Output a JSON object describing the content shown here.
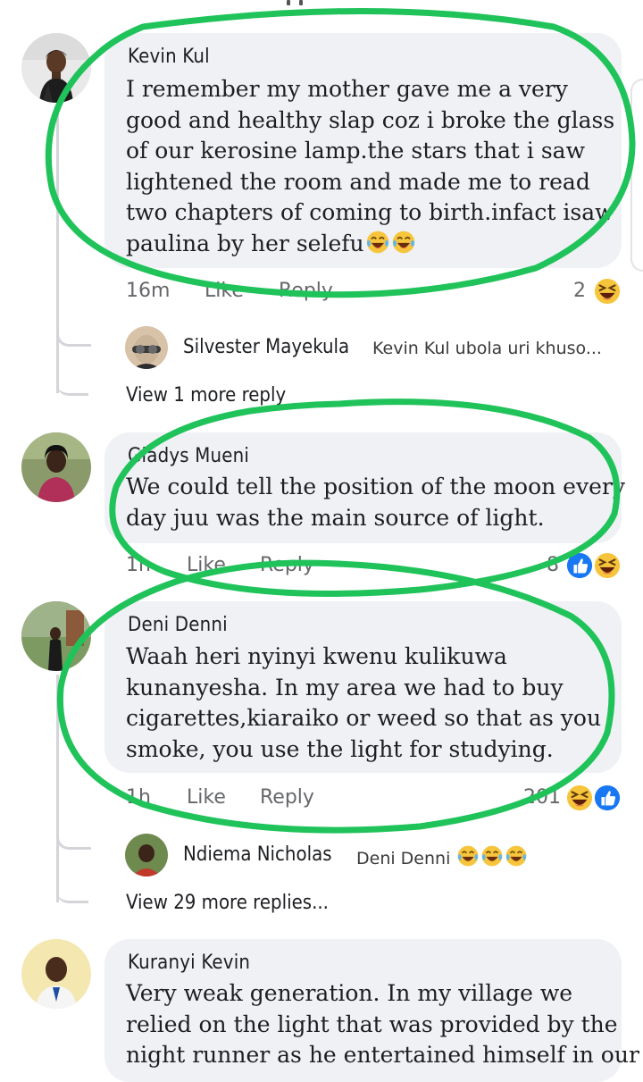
{
  "comments": [
    {
      "author": "Kevin Kul",
      "lines": [
        "I remember my mother gave me a very",
        "good and healthy slap coz i broke the glass",
        "of our kerosine lamp.the stars that i saw",
        "lightened the room and  made me to read",
        "two chapters of coming to birth.infact isaw",
        "paulina by her selefu"
      ],
      "time": "16m",
      "like": "Like",
      "reply": "Reply",
      "reaction_count": "2",
      "reactions": [
        "laugh-squint-emoji"
      ],
      "inline_emojis": [
        "tears-of-joy-emoji",
        "tears-of-joy-emoji"
      ],
      "replies": [
        {
          "name": "Silvester Mayekula",
          "snippet": "Kevin Kul ubola uri khuso..."
        }
      ],
      "view_more": "View 1 more reply"
    },
    {
      "author": "Gladys Mueni",
      "lines": [
        "We could tell the position of the moon every",
        "day juu was the main source of light."
      ],
      "time": "1h",
      "like": "Like",
      "reply": "Reply",
      "reaction_count": "8",
      "reactions": [
        "thumbs-up-emoji",
        "laugh-squint-emoji"
      ]
    },
    {
      "author": "Deni Denni",
      "lines": [
        "Waah heri nyinyi kwenu kulikuwa",
        "kunanyesha. In my area we had to buy",
        "cigarettes,kiaraiko or weed so that as you",
        "smoke, you use the light for studying."
      ],
      "time": "1h",
      "like": "Like",
      "reply": "Reply",
      "reaction_count": "201",
      "reactions": [
        "laugh-squint-emoji",
        "thumbs-up-emoji"
      ],
      "replies": [
        {
          "name": "Ndiema Nicholas",
          "snippet": "Deni Denni"
        }
      ],
      "reply_emojis": [
        "tears-of-joy-emoji",
        "tears-of-joy-emoji",
        "tears-of-joy-emoji"
      ],
      "view_more": "View 29 more replies..."
    },
    {
      "author": "Kuranyi Kevin",
      "lines": [
        "Very weak generation. In my village we",
        "relied on the light that was provided by the",
        "night runner as he entertained himself in our"
      ]
    }
  ],
  "colors": {
    "bubble": "#eff1f5",
    "meta_text": "#65676b",
    "annotation_ring": "#1fc35a",
    "like_blue": "#1877f2",
    "emoji_yellow": "#f7c53b"
  }
}
